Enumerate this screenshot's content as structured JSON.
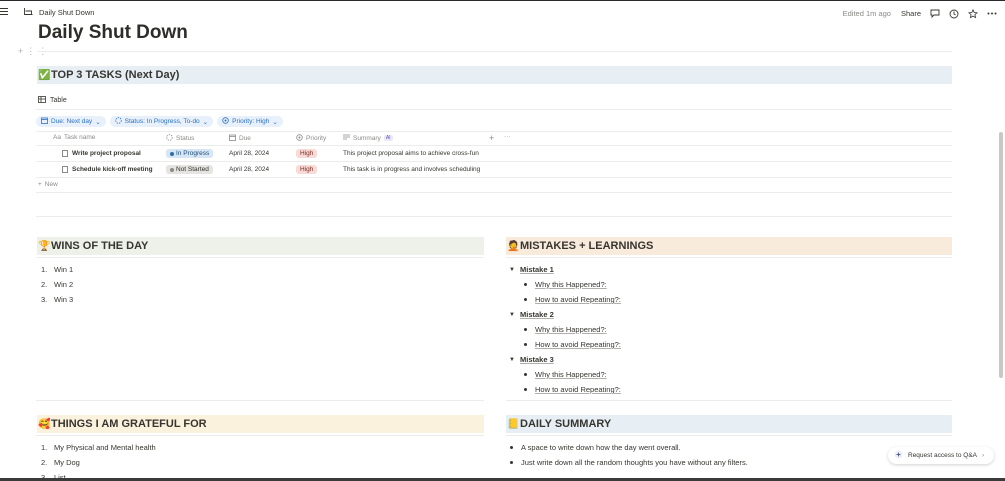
{
  "topbar": {
    "breadcrumb": "Daily Shut Down",
    "edited": "Edited 1m ago",
    "share_label": "Share",
    "icons": [
      "comment-icon",
      "clock-icon",
      "star-icon",
      "more-icon"
    ]
  },
  "page": {
    "title": "Daily Shut Down"
  },
  "top_tasks": {
    "heading": "TOP 3 TASKS (Next Day)",
    "heading_emoji": "✅",
    "view_label": "Table",
    "filters": [
      "Due: Next day",
      "Status: In Progress, To-do",
      "Priority: High"
    ],
    "columns": [
      "Task name",
      "Status",
      "Due",
      "Priority",
      "Summary"
    ],
    "ai_badge": "AI",
    "rows": [
      {
        "name": "Write project proposal",
        "status": "In Progress",
        "due": "April 28, 2024",
        "priority": "High",
        "summary": "This project proposal aims to achieve cross-fun"
      },
      {
        "name": "Schedule kick-off meeting",
        "status": "Not Started",
        "due": "April 28, 2024",
        "priority": "High",
        "summary": "This task is in progress and involves scheduling"
      }
    ],
    "new_label": "New"
  },
  "wins": {
    "heading": "WINS OF THE DAY",
    "heading_emoji": "🏆",
    "items": [
      "Win 1",
      "Win 2",
      "Win 3"
    ]
  },
  "mistakes": {
    "heading": "MISTAKES + LEARNINGS",
    "heading_emoji": "🤦",
    "groups": [
      {
        "title": "Mistake 1",
        "items": [
          "Why this Happened?:",
          "How to avoid Repeating?:"
        ]
      },
      {
        "title": "Mistake 2",
        "items": [
          "Why this Happened?:",
          "How to avoid Repeating?:"
        ]
      },
      {
        "title": "Mistake 3",
        "items": [
          "Why this Happened?:",
          "How to avoid Repeating?:"
        ]
      }
    ]
  },
  "grateful": {
    "heading": "THINGS I AM GRATEFUL FOR",
    "heading_emoji": "🥰",
    "items": [
      "My Physical and Mental health",
      "My Dog",
      "List"
    ]
  },
  "summary": {
    "heading": "DAILY SUMMARY",
    "heading_emoji": "📒",
    "items": [
      "A space to write down how the day went overall.",
      "Just write down all the random thoughts you have without any filters."
    ]
  },
  "request": {
    "label": "Request access to Q&A"
  },
  "colors": {
    "accent": "#2b71c2",
    "heading_blue": "#e7eff5",
    "heading_green": "#edf1ea",
    "heading_orange": "#f8ebdc",
    "heading_yellow": "#fbf2de"
  }
}
